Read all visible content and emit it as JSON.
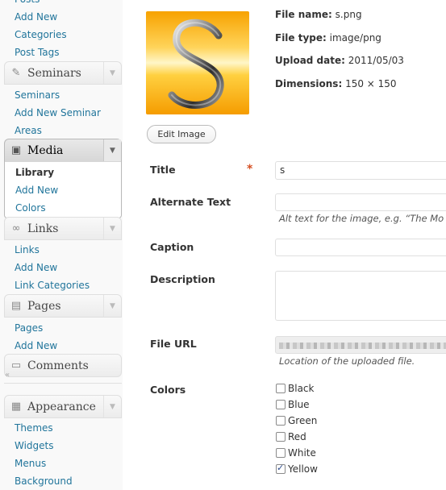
{
  "sidebar": {
    "posts": {
      "cut_item": "Posts",
      "items": [
        "Add New",
        "Categories",
        "Post Tags"
      ]
    },
    "seminars": {
      "label": "Seminars",
      "icon": "pushpin-icon",
      "items": [
        "Seminars",
        "Add New Seminar",
        "Areas"
      ]
    },
    "media": {
      "label": "Media",
      "icon": "media-icon",
      "items": [
        "Library",
        "Add New",
        "Colors"
      ],
      "current": "Library"
    },
    "links": {
      "label": "Links",
      "icon": "link-icon",
      "items": [
        "Links",
        "Add New",
        "Link Categories"
      ]
    },
    "pages": {
      "label": "Pages",
      "icon": "pages-icon",
      "items": [
        "Pages",
        "Add New"
      ]
    },
    "comments": {
      "label": "Comments",
      "icon": "comments-icon"
    },
    "appearance": {
      "label": "Appearance",
      "icon": "appearance-icon",
      "items": [
        "Themes",
        "Widgets",
        "Menus",
        "Background"
      ]
    }
  },
  "media_item": {
    "thumbnail_letter": "S",
    "file_name_label": "File name:",
    "file_name": "s.png",
    "file_type_label": "File type:",
    "file_type": "image/png",
    "upload_date_label": "Upload date:",
    "upload_date": "2011/05/03",
    "dimensions_label": "Dimensions:",
    "dimensions": "150 × 150",
    "edit_image_label": "Edit Image"
  },
  "form": {
    "title_label": "Title",
    "title_required": "*",
    "title_value": "s",
    "alt_label": "Alternate Text",
    "alt_help": "Alt text for the image, e.g. “The Mo",
    "caption_label": "Caption",
    "description_label": "Description",
    "file_url_label": "File URL",
    "file_url_help": "Location of the uploaded file.",
    "colors_label": "Colors",
    "colors": [
      {
        "name": "Black",
        "checked": false
      },
      {
        "name": "Blue",
        "checked": false
      },
      {
        "name": "Green",
        "checked": false
      },
      {
        "name": "Red",
        "checked": false
      },
      {
        "name": "White",
        "checked": false
      },
      {
        "name": "Yellow",
        "checked": true
      }
    ]
  },
  "colors": {
    "link": "#21759b",
    "required": "#d54e21",
    "thumb_top": "#fffbe0",
    "thumb_bottom": "#f5a000"
  }
}
